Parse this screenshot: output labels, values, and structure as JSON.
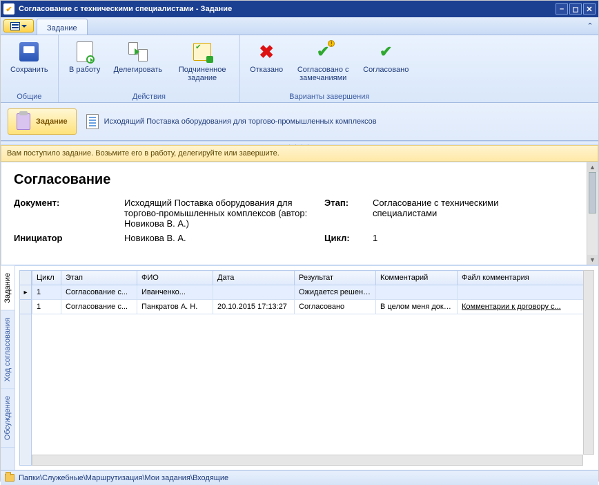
{
  "window": {
    "title": "Согласование с техническими специалистами - Задание"
  },
  "tab": {
    "label": "Задание"
  },
  "ribbon": {
    "groups": {
      "common": {
        "label": "Общие",
        "save": "Сохранить"
      },
      "actions": {
        "label": "Действия",
        "to_work": "В работу",
        "delegate": "Делегировать",
        "subtask": "Подчиненное задание"
      },
      "outcomes": {
        "label": "Варианты завершения",
        "rejected": "Отказано",
        "agreed_remarks": "Согласовано с замечаниями",
        "agreed": "Согласовано"
      }
    }
  },
  "header": {
    "task_button": "Задание",
    "doc_link": "Исходящий Поставка оборудования для торгово-промышленных комплексов"
  },
  "infobar": "Вам поступило задание. Возьмите его в работу, делегируйте или завершите.",
  "details": {
    "title": "Согласование",
    "labels": {
      "document": "Документ:",
      "stage": "Этап:",
      "initiator": "Инициатор",
      "cycle": "Цикл:"
    },
    "document": "Исходящий Поставка оборудования для торгово-промышленных комплексов (автор: Новикова В. А.)",
    "stage": "Согласование с техническими специалистами",
    "initiator": "Новикова В. А.",
    "cycle": "1"
  },
  "vtabs": {
    "task": "Задание",
    "progress": "Ход согласования",
    "discussion": "Обсуждение"
  },
  "grid": {
    "columns": {
      "cycle": "Цикл",
      "stage": "Этап",
      "fio": "ФИО",
      "date": "Дата",
      "result": "Результат",
      "comment": "Комментарий",
      "file": "Файл комментария"
    },
    "rows": [
      {
        "cycle": "1",
        "stage": "Согласование с...",
        "fio": "Иванченко...",
        "date": "",
        "result": "Ожидается решение",
        "comment": "",
        "file": ""
      },
      {
        "cycle": "1",
        "stage": "Согласование с...",
        "fio": "Панкратов А. Н.",
        "date": "20.10.2015 17:13:27",
        "result": "Согласовано",
        "comment": "В целом меня доку...",
        "file": "Комментарии к договору с..."
      }
    ]
  },
  "statusbar": "Папки\\Служебные\\Маршрутизация\\Мои задания\\Входящие"
}
